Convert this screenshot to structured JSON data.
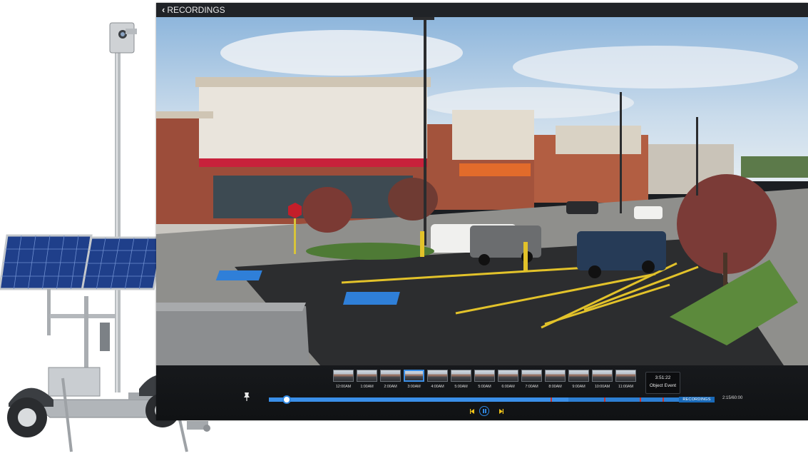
{
  "header": {
    "back_label": "RECORDINGS"
  },
  "timeline": {
    "thumbnails": [
      {
        "time": "12:00AM"
      },
      {
        "time": "1:00AM"
      },
      {
        "time": "2:00AM"
      },
      {
        "time": "3:00AM"
      },
      {
        "time": "4:00AM"
      },
      {
        "time": "5:00AM"
      },
      {
        "time": "5:00AM"
      },
      {
        "time": "6:00AM"
      },
      {
        "time": "7:00AM"
      },
      {
        "time": "8:00AM"
      },
      {
        "time": "9:00AM"
      },
      {
        "time": "10:00AM"
      },
      {
        "time": "11:00AM"
      }
    ],
    "active_index": 3,
    "event": {
      "time": "3:51:22",
      "label": "Object Event"
    },
    "segment_label": "RECORDINGS",
    "readout": "2:15/60:00",
    "playhead_fraction": 0.04
  },
  "colors": {
    "accent": "#2f86de",
    "event_marker": "#c7372f",
    "panel": "#1b1e22"
  },
  "icons": {
    "back": "chevron-left-icon",
    "pin": "pin-icon",
    "prev": "skip-back-icon",
    "play_state": "pause-icon",
    "next": "skip-forward-icon"
  }
}
